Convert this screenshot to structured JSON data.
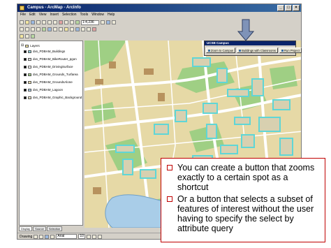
{
  "window": {
    "title": "Campus - ArcMap - ArcInfo",
    "buttons": [
      "_",
      "□",
      "×"
    ]
  },
  "menu": [
    "File",
    "Edit",
    "View",
    "Insert",
    "Selection",
    "Tools",
    "Window",
    "Help"
  ],
  "toolbar": {
    "scale_value": "1:4,236"
  },
  "toc": {
    "root_label": "Layers",
    "layers": [
      "dxs_PDBAM_Buildings",
      "dxs_PDBAM_BikeRouter_pgon",
      "dxs_PDBAM_DrivingSurface",
      "dxs_PDBAM_Grounds_Turfarea",
      "dxs_PDBAM_GroundsAlone",
      "dxs_PDBAM_Lagoon",
      "dxs_PDBAM_Graphic_Background"
    ],
    "tabs": [
      "Display",
      "Source",
      "Selection"
    ]
  },
  "floating_toolbar": {
    "title": "UCSB Campus",
    "buttons": [
      "Zoom to Campus",
      "Buildings with Classrooms",
      "Run Project"
    ]
  },
  "statusbar": {
    "drawing_label": "Drawing",
    "font_name": "Arial",
    "font_size": "10"
  },
  "callout": {
    "bullets": [
      "You can create a button that zooms exactly to a certain spot as a shortcut",
      "Or a button that selects a subset of features of interest without the user having to specify the select by attribute query"
    ]
  },
  "colors": {
    "accent_red": "#c00000",
    "titlebar_blue": "#0a246a",
    "map_background": "#e6d9a6",
    "building": "#8fd0d8",
    "turf": "#9fcf84",
    "lagoon": "#a9cde8"
  }
}
